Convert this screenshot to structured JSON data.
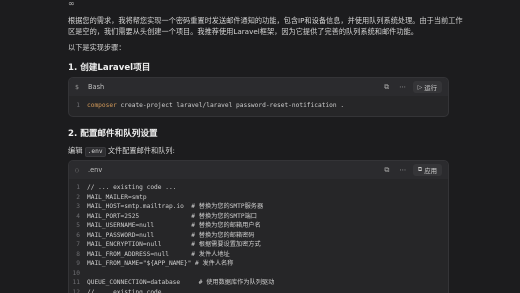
{
  "top_icon": "∞",
  "intro_paragraph": "根据您的需求，我将帮您实现一个密码重置时发送邮件通知的功能，包含IP和设备信息，并使用队列系统处理。由于当前工作区是空的，我们需要从头创建一个项目。我推荐使用Laravel框架，因为它提供了完善的队列系统和邮件功能。",
  "steps_intro": "以下是实现步骤：",
  "section1_heading": "1. 创建Laravel项目",
  "block1": {
    "language": "Bash",
    "run_label": "运行",
    "lines": [
      {
        "n": "1",
        "cmd": "composer",
        "rest": " create-project laravel/laravel password-reset-notification ."
      }
    ]
  },
  "section2_heading": "2. 配置邮件和队列设置",
  "edit_prefix": "编辑 ",
  "edit_file": ".env",
  "edit_suffix": " 文件配置邮件和队列:",
  "block2": {
    "language": ".env",
    "apply_label": "应用",
    "lines": [
      {
        "n": "1",
        "text": "// ... existing code ..."
      },
      {
        "n": "2",
        "text": "MAIL_MAILER=smtp"
      },
      {
        "n": "3",
        "text": "MAIL_HOST=smtp.mailtrap.io  # 替换为您的SMTP服务器"
      },
      {
        "n": "4",
        "text": "MAIL_PORT=2525              # 替换为您的SMTP端口"
      },
      {
        "n": "5",
        "text": "MAIL_USERNAME=null          # 替换为您的邮箱用户名"
      },
      {
        "n": "6",
        "text": "MAIL_PASSWORD=null          # 替换为您的邮箱密码"
      },
      {
        "n": "7",
        "text": "MAIL_ENCRYPTION=null        # 根据需要设置加密方式"
      },
      {
        "n": "8",
        "text": "MAIL_FROM_ADDRESS=null      # 发件人地址"
      },
      {
        "n": "9",
        "text": "MAIL_FROM_NAME=\"${APP_NAME}\" # 发件人名称"
      },
      {
        "n": "10",
        "text": ""
      },
      {
        "n": "11",
        "text": "QUEUE_CONNECTION=database     # 使用数据库作为队列驱动"
      },
      {
        "n": "12",
        "text": "// ... existing code ..."
      }
    ]
  }
}
